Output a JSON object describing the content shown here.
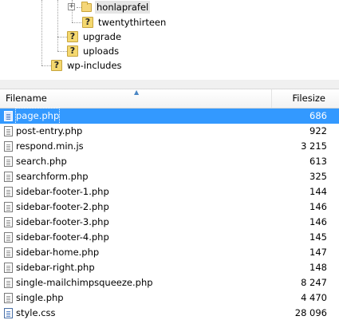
{
  "tree": {
    "nodes": [
      {
        "label": "honlaprafel",
        "icon": "folder-icon",
        "selected": true,
        "expander": "+"
      },
      {
        "label": "twentythirteen",
        "icon": "unknown-folder-icon"
      },
      {
        "label": "upgrade",
        "icon": "unknown-folder-icon"
      },
      {
        "label": "uploads",
        "icon": "unknown-folder-icon"
      },
      {
        "label": "wp-includes",
        "icon": "unknown-folder-icon"
      }
    ]
  },
  "list": {
    "columns": {
      "name": "Filename",
      "size": "Filesize"
    },
    "sort_indicator": "▲",
    "files": [
      {
        "name": "page.php",
        "size": "686",
        "selected": true
      },
      {
        "name": "post-entry.php",
        "size": "922"
      },
      {
        "name": "respond.min.js",
        "size": "3 215"
      },
      {
        "name": "search.php",
        "size": "613"
      },
      {
        "name": "searchform.php",
        "size": "325"
      },
      {
        "name": "sidebar-footer-1.php",
        "size": "144"
      },
      {
        "name": "sidebar-footer-2.php",
        "size": "146"
      },
      {
        "name": "sidebar-footer-3.php",
        "size": "146"
      },
      {
        "name": "sidebar-footer-4.php",
        "size": "145"
      },
      {
        "name": "sidebar-home.php",
        "size": "147"
      },
      {
        "name": "sidebar-right.php",
        "size": "148"
      },
      {
        "name": "single-mailchimpsqueeze.php",
        "size": "8 247"
      },
      {
        "name": "single.php",
        "size": "4 470"
      },
      {
        "name": "style.css",
        "size": "28 096",
        "icon": "css"
      }
    ]
  },
  "colors": {
    "selection": "#3399ff",
    "folder": "#f5d679"
  }
}
